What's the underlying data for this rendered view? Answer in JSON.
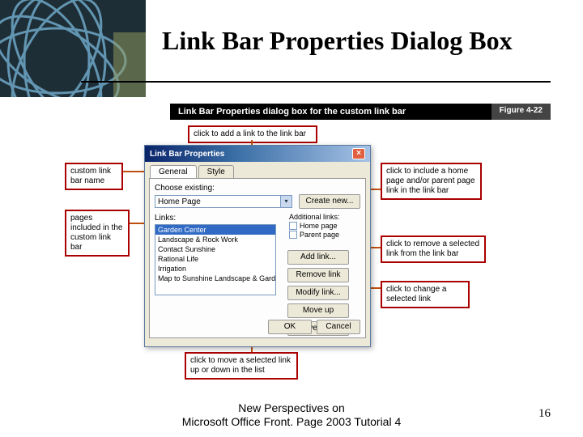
{
  "slide": {
    "title": "Link Bar Properties Dialog Box",
    "footer_line1": "New Perspectives on",
    "footer_line2": "Microsoft Office Front. Page 2003 Tutorial 4",
    "page_number": "16"
  },
  "figure": {
    "caption": "Link Bar Properties dialog box for the custom link bar",
    "tag": "Figure 4-22"
  },
  "callouts": {
    "add_link": "click to add a link to the link bar",
    "custom_name": "custom link bar name",
    "pages_included": "pages included in the custom link bar",
    "include_home": "click to include a home page and/or parent page link in the link bar",
    "remove": "click to remove a selected link from the link bar",
    "change": "click to change a selected link",
    "move": "click to move a selected link up or down in the list"
  },
  "dialog": {
    "title": "Link Bar Properties",
    "tabs": {
      "general": "General",
      "style": "Style"
    },
    "choose_label": "Choose existing:",
    "existing_value": "Home Page",
    "create_new_btn": "Create new...",
    "links_label": "Links:",
    "link_items": [
      "Garden Center",
      "Landscape & Rock Work",
      "Contact Sunshine",
      "Rational Life",
      "Irrigation",
      "Map to Sunshine Landscape & Garden Cen"
    ],
    "buttons": {
      "add": "Add link...",
      "remove": "Remove link",
      "modify": "Modify link...",
      "up": "Move up",
      "down": "Move down"
    },
    "additional_label": "Additional links:",
    "chk_home": "Home page",
    "chk_parent": "Parent page",
    "ok": "OK",
    "cancel": "Cancel"
  }
}
